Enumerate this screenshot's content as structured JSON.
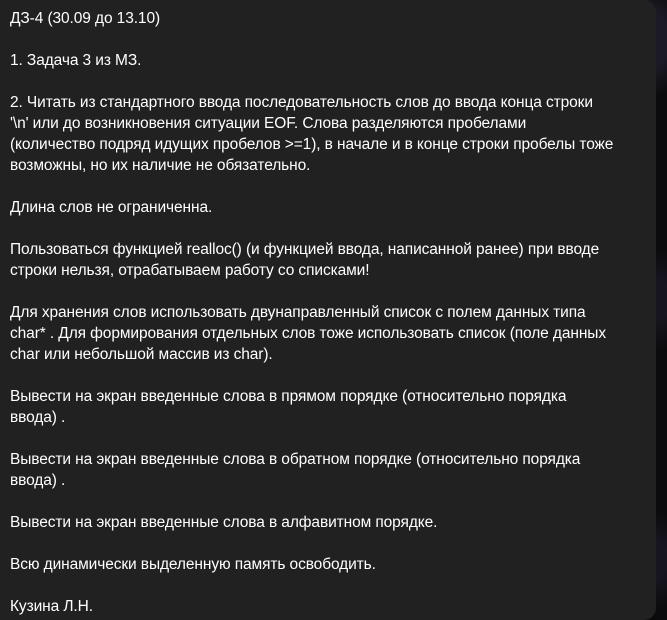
{
  "message": {
    "title": "ДЗ-4 (30.09 до 13.10)",
    "p1": "1. Задача 3 из МЗ.",
    "p2_l1": "2. Читать из стандартного ввода последовательность слов до ввода конца строки",
    "p2_l2": "'\\n' или до возникновения ситуации EOF. Слова разделяются пробелами",
    "p2_l3": "(количество подряд идущих пробелов >=1), в начале и в конце строки пробелы тоже",
    "p2_l4": "возможны, но их наличие не обязательно.",
    "p3": "Длина слов не ограниченна.",
    "p4_l1": "Пользоваться функцией realloc() (и функцией ввода, написанной ранее) при вводе",
    "p4_l2": "строки нельзя, отрабатываем работу со списками!",
    "p5_l1": "Для хранения слов использовать двунаправленный список с полем данных типа",
    "p5_l2": "char* . Для формирования отдельных слов тоже использовать список (поле данных",
    "p5_l3": "char или небольшой массив из char).",
    "p6_l1": "Вывести на экран введенные слова в прямом порядке (относительно порядка",
    "p6_l2": "ввода) .",
    "p7_l1": "Вывести на экран введенные слова в обратном порядке (относительно порядка",
    "p7_l2": "ввода) .",
    "p8": "Вывести на экран введенные слова в алфавитном порядке.",
    "p9": "Всю динамически выделенную память освободить.",
    "signature": "Кузина Л.Н."
  },
  "colors": {
    "bubble_bg": "#212121",
    "text": "#ffffff",
    "chat_bg": "#0b0b0d"
  }
}
